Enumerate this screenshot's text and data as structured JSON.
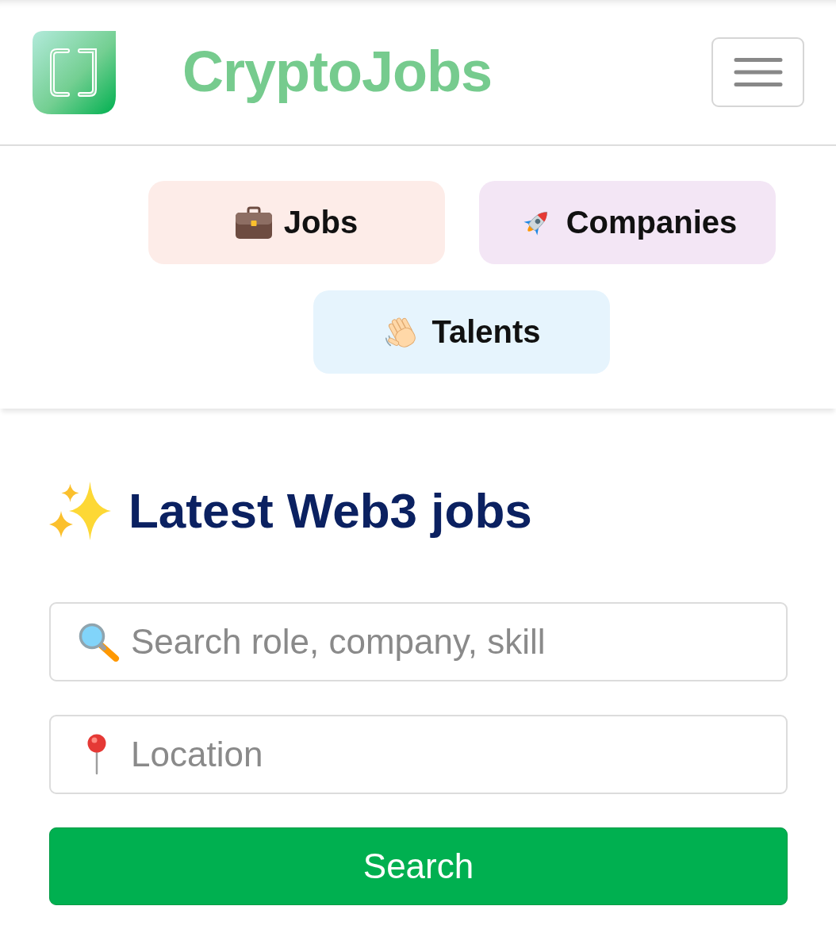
{
  "header": {
    "brand": "CryptoJobs"
  },
  "nav": [
    {
      "label": "Jobs",
      "color": "#fdece8"
    },
    {
      "label": "Companies",
      "color": "#f3e6f5"
    },
    {
      "label": "Talents",
      "color": "#e6f4fd"
    }
  ],
  "main": {
    "title": "Latest Web3 jobs",
    "fields": [
      {
        "placeholder": "Search role, company, skill"
      },
      {
        "placeholder": "Location"
      }
    ],
    "button": "Search"
  }
}
